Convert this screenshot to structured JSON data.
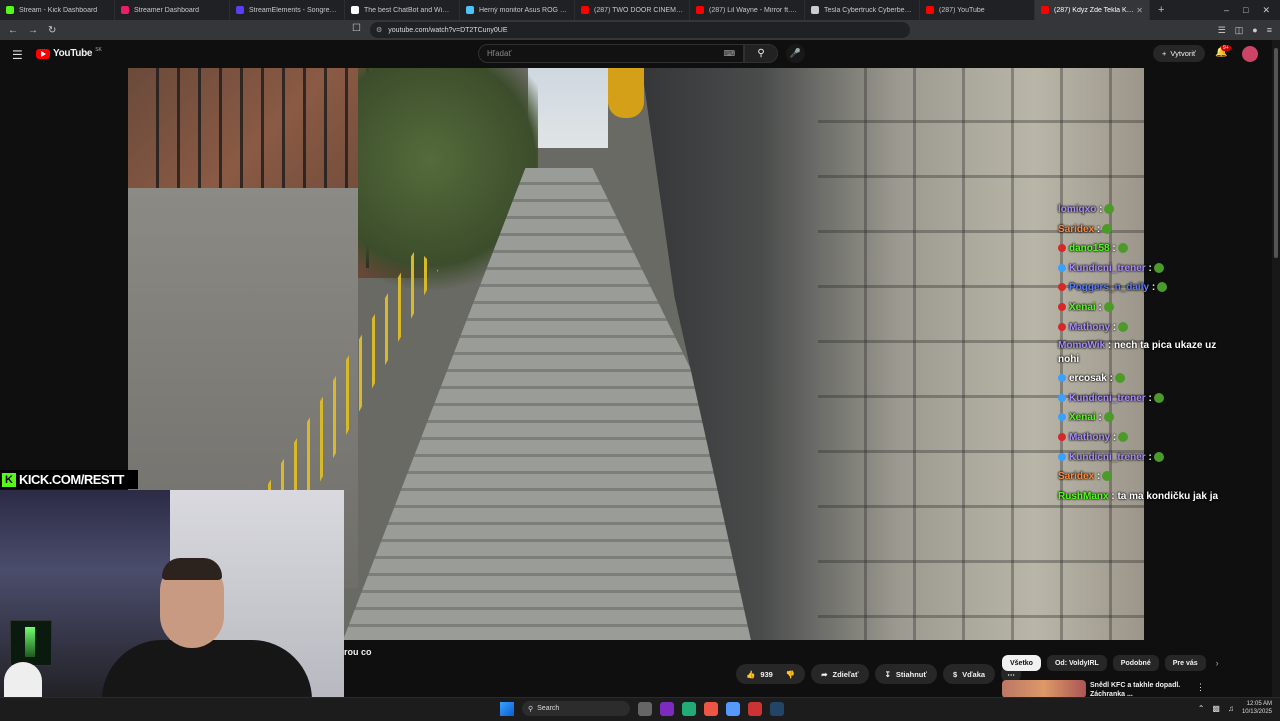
{
  "browser": {
    "tabs": [
      {
        "label": "Stream - Kick Dashboard",
        "color": "#53fc18"
      },
      {
        "label": "Streamer Dashboard",
        "color": "#e91e63"
      },
      {
        "label": "StreamElements - Songrequest",
        "color": "#5a3df5"
      },
      {
        "label": "The best ChatBot and Widgets for",
        "color": "#ffffff"
      },
      {
        "label": "Herný monitor Asus ROG Strix OLE",
        "color": "#4fc3f7"
      },
      {
        "label": "(287) TWO DOOR CINEMA CLUB |",
        "color": "#ff0000"
      },
      {
        "label": "(287) Lil Wayne - Mirror ft. Bruno",
        "color": "#ff0000"
      },
      {
        "label": "Tesla Cybertruck Cyberbeast Electr",
        "color": "#cccccc"
      },
      {
        "label": "(287) YouTube",
        "color": "#ff0000"
      },
      {
        "label": "(287) Kdyz Zde Tekla KREV",
        "color": "#ff0000",
        "active": true
      }
    ],
    "url": "youtube.com/watch?v=DT2TCuny0UE"
  },
  "youtube": {
    "logo": "YouTube",
    "region": "SK",
    "search_placeholder": "Hľadať",
    "create_label": "Vytvoriť",
    "notif_badge": "9+",
    "video_title": "rou co",
    "likes": "939",
    "share_label": "Zdieľať",
    "download_label": "Stiahnuť",
    "thanks_label": "Vďaka",
    "chips": [
      "Všetko",
      "Od: VoldyIRL",
      "Podobné",
      "Pre vás"
    ],
    "rec_title": "Snědl KFC a takhle dopadl. Záchranka ..."
  },
  "overlay": {
    "kick_text": "KICK.COM/RESTT",
    "chat": [
      {
        "user": "lomiqxo",
        "color": "#a88cff",
        "text": ":",
        "badge": "",
        "emote": true
      },
      {
        "user": "Saridex",
        "color": "#ff8a3d",
        "text": ":",
        "badge": "",
        "emote": true
      },
      {
        "user": "dano158",
        "color": "#53fc18",
        "text": ":",
        "badge": "#d62828",
        "emote": true
      },
      {
        "user": "Kundicni_trener",
        "color": "#a88cff",
        "text": ":",
        "badge": "#3aa0ff",
        "emote": true
      },
      {
        "user": "Poggers_n_daily",
        "color": "#5b7cff",
        "text": ":",
        "badge": "#d62828",
        "emote": true
      },
      {
        "user": "Xenai",
        "color": "#53fc18",
        "text": ":",
        "badge": "#d62828",
        "emote": true
      },
      {
        "user": "Mathony",
        "color": "#a88cff",
        "text": ":",
        "badge": "#d62828",
        "emote": true
      },
      {
        "user": "MomoWik",
        "color": "#a88cff",
        "text": ": nech ta pica ukaze uz nohi",
        "badge": "",
        "emote": false,
        "wrap": true
      },
      {
        "user": "ercosak",
        "color": "#ffffff",
        "text": ":",
        "badge": "#3aa0ff",
        "emote": true
      },
      {
        "user": "Kundicni_trener",
        "color": "#a88cff",
        "text": ":",
        "badge": "#3aa0ff",
        "emote": true
      },
      {
        "user": "Xenai",
        "color": "#53fc18",
        "text": ":",
        "badge": "#3aa0ff",
        "emote": true
      },
      {
        "user": "Mathony",
        "color": "#a88cff",
        "text": ":",
        "badge": "#d62828",
        "emote": true
      },
      {
        "user": "Kundicni_trener",
        "color": "#a88cff",
        "text": ":",
        "badge": "#3aa0ff",
        "emote": true
      },
      {
        "user": "Saridex",
        "color": "#ff8a3d",
        "text": ":",
        "badge": "",
        "emote": true
      },
      {
        "user": "RushManx",
        "color": "#53fc18",
        "text": ": ta ma kondičku jak ja",
        "badge": "",
        "emote": false
      }
    ]
  },
  "taskbar": {
    "search_label": "Search",
    "time": "12:05 AM",
    "date": "10/13/2025"
  }
}
